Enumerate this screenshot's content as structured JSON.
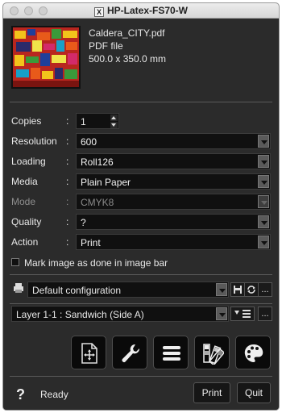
{
  "window": {
    "title": "HP-Latex-FS70-W",
    "app_icon_text": "X"
  },
  "file": {
    "name": "Caldera_CITY.pdf",
    "type": "PDF file",
    "size": "500.0 x 350.0 mm"
  },
  "fields": {
    "copies": {
      "label": "Copies",
      "value": "1"
    },
    "resolution": {
      "label": "Resolution",
      "value": "600"
    },
    "loading": {
      "label": "Loading",
      "value": "Roll126"
    },
    "media": {
      "label": "Media",
      "value": "Plain Paper"
    },
    "mode": {
      "label": "Mode",
      "value": "CMYK8"
    },
    "quality": {
      "label": "Quality",
      "value": "?"
    },
    "action": {
      "label": "Action",
      "value": "Print"
    },
    "colon": ":"
  },
  "mark_done": {
    "label": "Mark image as done in image bar",
    "checked": false
  },
  "configuration": {
    "value": "Default configuration",
    "more": "..."
  },
  "layer": {
    "value": "Layer 1-1 : Sandwich (Side A)",
    "more": "..."
  },
  "tools": [
    {
      "name": "placement-icon"
    },
    {
      "name": "wrench-icon"
    },
    {
      "name": "list-icon"
    },
    {
      "name": "swatch-icon"
    },
    {
      "name": "palette-icon"
    }
  ],
  "footer": {
    "help": "?",
    "status": "Ready",
    "print": "Print",
    "quit": "Quit"
  }
}
